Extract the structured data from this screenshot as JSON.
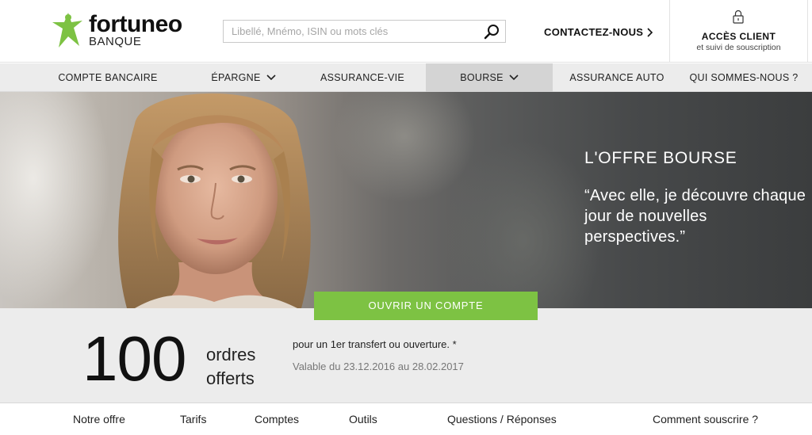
{
  "header": {
    "logo_name": "fortuneo",
    "logo_sub": "BANQUE",
    "search_placeholder": "Libellé, Mnémo, ISIN ou mots clés",
    "contact_label": "CONTACTEZ-NOUS",
    "client_title": "ACCÈS CLIENT",
    "client_sub": "et suivi de souscription"
  },
  "nav": {
    "items": [
      {
        "label": "COMPTE BANCAIRE"
      },
      {
        "label": "ÉPARGNE"
      },
      {
        "label": "ASSURANCE-VIE"
      },
      {
        "label": "BOURSE"
      },
      {
        "label": "ASSURANCE AUTO"
      },
      {
        "label": "QUI SOMMES-NOUS ?"
      }
    ]
  },
  "hero": {
    "title": "L'OFFRE BOURSE",
    "quote": "“Avec elle, je découvre chaque jour de nouvelles perspectives.”",
    "cta": "OUVRIR UN COMPTE"
  },
  "offer": {
    "number": "100",
    "label_line1": "ordres",
    "label_line2": "offerts",
    "line1": "pour un 1er transfert ou ouverture. *",
    "line2": "Valable du 23.12.2016 au 28.02.2017"
  },
  "tabs": [
    {
      "label": "Notre offre"
    },
    {
      "label": "Tarifs"
    },
    {
      "label": "Comptes"
    },
    {
      "label": "Outils"
    },
    {
      "label": "Questions / Réponses"
    },
    {
      "label": "Comment souscrire ?"
    }
  ],
  "colors": {
    "brand_green": "#7dc243",
    "nav_bg": "#ececec",
    "nav_active_bg": "#d4d4d4"
  },
  "icons": {
    "logo": "fortuneo-star-man-icon",
    "search": "search-icon",
    "contact": "chevron-right-icon",
    "client": "lock-icon",
    "nav_dropdown": "chevron-down-icon"
  }
}
